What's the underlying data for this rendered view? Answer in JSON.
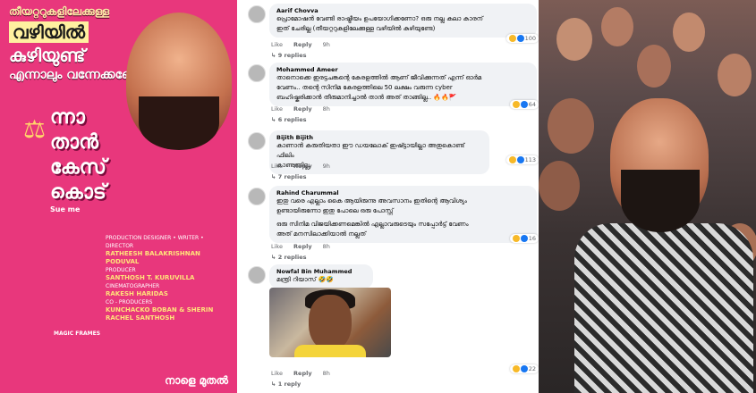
{
  "poster": {
    "tagline": [
      "തീയറ്ററുകളിലേക്കുള്ള",
      "വഴിയിൽ",
      "കുഴിയുണ്ട്",
      "എന്നാലും വന്നേക്കണേ"
    ],
    "title_lines": [
      "ന്നാ",
      "താൻ",
      "കേസ്",
      "കൊട്"
    ],
    "subtitle": "Sue me",
    "credits": [
      {
        "role": "PRODUCTION DESIGNER • WRITER • DIRECTOR",
        "name": "RATHEESH BALAKRISHNAN PODUVAL"
      },
      {
        "role": "PRODUCER",
        "name": "SANTHOSH T. KURUVILLA"
      },
      {
        "role": "CINEMATOGRAPHER",
        "name": "RAKESH HARIDAS"
      },
      {
        "role": "CO - PRODUCERS",
        "name": "KUNCHACKO BOBAN & SHERIN RACHEL SANTHOSH"
      }
    ],
    "studio": "MAGIC FRAMES",
    "release": "നാളെ മുതൽ"
  },
  "comments": [
    {
      "name": "Aarif Chovva",
      "text": [
        "പ്രൊമോഷൻ വേണ്ടി രാഷ്ട്രീയം ഉപയോഗിക്കണോ? ഒരു നല്ല കലാ കാരന്",
        "ഇത് ചേരില്ല (തീയറ്ററുകളിലേക്കുള്ള വഴിയിൽ കുഴിയുണ്ടേ)"
      ],
      "like": "Like",
      "reply": "Reply",
      "time": "9h",
      "replies": "9 replies",
      "reactions": "100"
    },
    {
      "name": "Mohammed Ameer",
      "text": [
        "താനൊക്കെ ഇരട്ടചങ്കന്റെ കേരളത്തിൽ ആണ് ജീവിക്കുന്നത് എന്ന് ഓർമ",
        "വേണം.. തന്റെ സിനിമ കേരളത്തിലെ 50 ലക്ഷം വരുന്ന cyber",
        "ബഹിഷ്കരിക്കാൻ തീരുമാനിച്ചാൽ താൻ അത് താങ്ങില്ല.. 🔥🔥🚩"
      ],
      "like": "Like",
      "reply": "Reply",
      "time": "8h",
      "replies": "6 replies",
      "reactions": "64"
    },
    {
      "name": "Bijith Bijith",
      "text": [
        "കാണാൻ കരുതിയതാ ഈ ഡയലോക് ഇഷ്ട്ടായില്ലാ അതുകൊണ്ട് ഫിലിം",
        "കാണുന്നില്ല."
      ],
      "like": "Like",
      "reply": "Reply",
      "time": "9h",
      "replies": "7 replies",
      "reactions": "113"
    },
    {
      "name": "Rahind Charummal",
      "text": [
        "ഇതു വരെ എല്ലാം കൈ ആയിരുന്നു അവസാനം ഇതിന്റെ ആവിശ്യം",
        "ഉണ്ടായിരുന്നോ ഇതു പോലെ ഒരു പോസ്റ്റ്",
        "ഒരു സിനിമ വിജയിക്കണമെങ്കിൽ എല്ലാവരുടെയും സപ്പോർട്ട് വേണം",
        "അത് മനസിലാക്കിയാൽ നല്ലത്"
      ],
      "like": "Like",
      "reply": "Reply",
      "time": "8h",
      "replies": "2 replies",
      "reactions": "16"
    },
    {
      "name": "Nowfal Bin Muhammed",
      "text": [
        "മന്ത്രി റിയാസ് 🤣🤣"
      ],
      "like": "Like",
      "reply": "Reply",
      "time": "8h",
      "replies": "1 reply",
      "reactions": "22"
    }
  ],
  "colors": {
    "poster_bg": "#e8377c",
    "bubble_bg": "#f0f2f5",
    "meta_text": "#65676b"
  }
}
